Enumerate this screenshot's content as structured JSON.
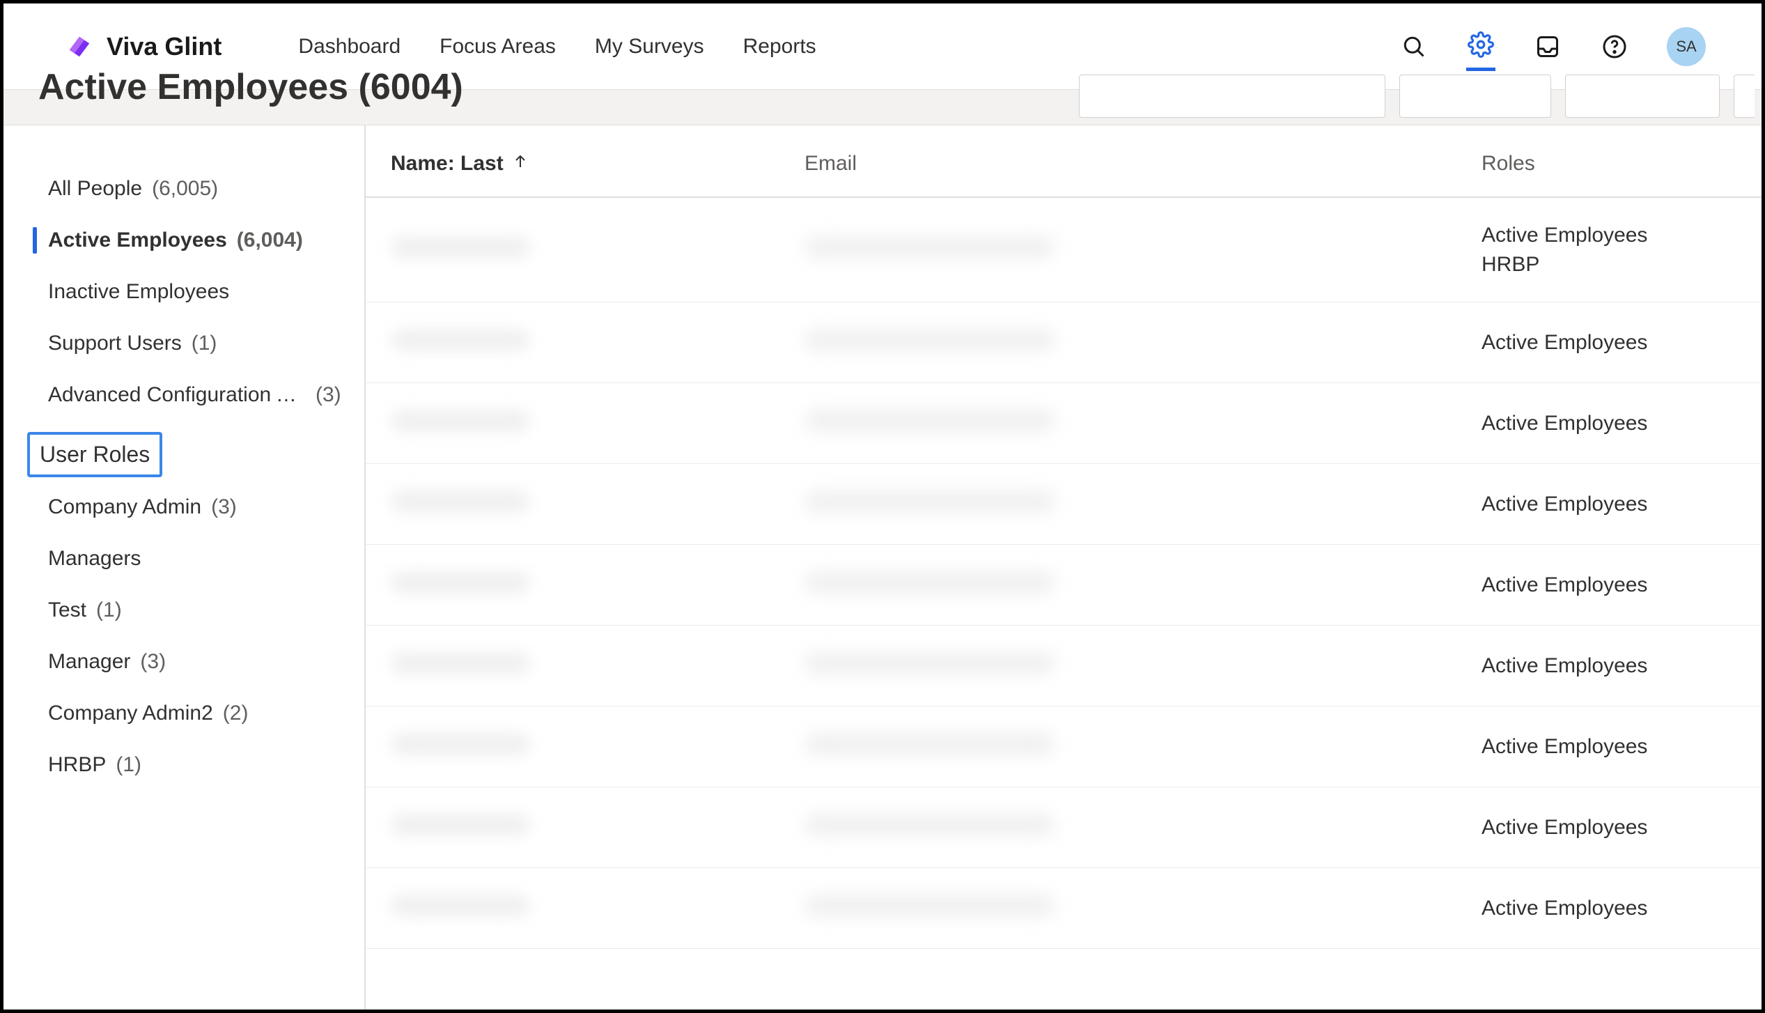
{
  "header": {
    "product_name": "Viva Glint",
    "nav": [
      "Dashboard",
      "Focus Areas",
      "My Surveys",
      "Reports"
    ],
    "avatar_initials": "SA"
  },
  "page": {
    "title": "Active Employees (6004)"
  },
  "sidebar": {
    "groups1": [
      {
        "label": "All People",
        "count": "(6,005)",
        "active": false
      },
      {
        "label": "Active Employees",
        "count": "(6,004)",
        "active": true
      },
      {
        "label": "Inactive Employees",
        "count": "",
        "active": false
      },
      {
        "label": "Support Users",
        "count": "(1)",
        "active": false
      },
      {
        "label": "Advanced Configuration Acc…",
        "count": "(3)",
        "active": false
      }
    ],
    "section_label": "User Roles",
    "groups2": [
      {
        "label": "Company Admin",
        "count": "(3)"
      },
      {
        "label": "Managers",
        "count": ""
      },
      {
        "label": "Test",
        "count": "(1)"
      },
      {
        "label": "Manager",
        "count": "(3)"
      },
      {
        "label": "Company Admin2",
        "count": "(2)"
      },
      {
        "label": "HRBP",
        "count": "(1)"
      }
    ]
  },
  "table": {
    "columns": {
      "name": "Name: Last",
      "email": "Email",
      "roles": "Roles"
    },
    "sort_asc_on": "name",
    "rows": [
      {
        "roles": "Active Employees\nHRBP"
      },
      {
        "roles": "Active Employees"
      },
      {
        "roles": "Active Employees"
      },
      {
        "roles": "Active Employees"
      },
      {
        "roles": "Active Employees"
      },
      {
        "roles": "Active Employees"
      },
      {
        "roles": "Active Employees"
      },
      {
        "roles": "Active Employees"
      },
      {
        "roles": "Active Employees"
      }
    ]
  }
}
